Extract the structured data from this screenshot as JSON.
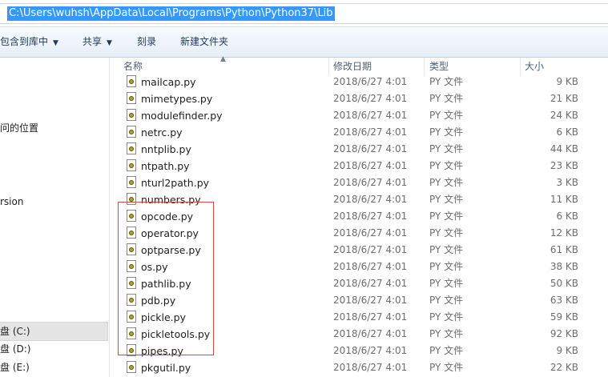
{
  "address_bar": {
    "path": "C:\\Users\\wuhsh\\AppData\\Local\\Programs\\Python\\Python37\\Lib"
  },
  "toolbar": {
    "include_in_library": "包含到库中",
    "share": "共享",
    "burn": "刻录",
    "new_folder": "新建文件夹"
  },
  "nav": {
    "recent_places": "问的位置",
    "version_item": "rsion",
    "drive_c": "盘 (C:)",
    "drive_d": "盘 (D:)",
    "drive_e": "盘 (E:)"
  },
  "columns": {
    "name": "名称",
    "date": "修改日期",
    "type": "类型",
    "size": "大小"
  },
  "files": [
    {
      "name": "mailcap.py",
      "date": "2018/6/27 4:01",
      "type": "PY 文件",
      "size": "9 KB"
    },
    {
      "name": "mimetypes.py",
      "date": "2018/6/27 4:01",
      "type": "PY 文件",
      "size": "21 KB"
    },
    {
      "name": "modulefinder.py",
      "date": "2018/6/27 4:01",
      "type": "PY 文件",
      "size": "24 KB"
    },
    {
      "name": "netrc.py",
      "date": "2018/6/27 4:01",
      "type": "PY 文件",
      "size": "6 KB"
    },
    {
      "name": "nntplib.py",
      "date": "2018/6/27 4:01",
      "type": "PY 文件",
      "size": "44 KB"
    },
    {
      "name": "ntpath.py",
      "date": "2018/6/27 4:01",
      "type": "PY 文件",
      "size": "23 KB"
    },
    {
      "name": "nturl2path.py",
      "date": "2018/6/27 4:01",
      "type": "PY 文件",
      "size": "3 KB"
    },
    {
      "name": "numbers.py",
      "date": "2018/6/27 4:01",
      "type": "PY 文件",
      "size": "11 KB"
    },
    {
      "name": "opcode.py",
      "date": "2018/6/27 4:01",
      "type": "PY 文件",
      "size": "6 KB"
    },
    {
      "name": "operator.py",
      "date": "2018/6/27 4:01",
      "type": "PY 文件",
      "size": "12 KB"
    },
    {
      "name": "optparse.py",
      "date": "2018/6/27 4:01",
      "type": "PY 文件",
      "size": "61 KB"
    },
    {
      "name": "os.py",
      "date": "2018/6/27 4:01",
      "type": "PY 文件",
      "size": "38 KB"
    },
    {
      "name": "pathlib.py",
      "date": "2018/6/27 4:01",
      "type": "PY 文件",
      "size": "50 KB"
    },
    {
      "name": "pdb.py",
      "date": "2018/6/27 4:01",
      "type": "PY 文件",
      "size": "63 KB"
    },
    {
      "name": "pickle.py",
      "date": "2018/6/27 4:01",
      "type": "PY 文件",
      "size": "59 KB"
    },
    {
      "name": "pickletools.py",
      "date": "2018/6/27 4:01",
      "type": "PY 文件",
      "size": "92 KB"
    },
    {
      "name": "pipes.py",
      "date": "2018/6/27 4:01",
      "type": "PY 文件",
      "size": "9 KB"
    },
    {
      "name": "pkgutil.py",
      "date": "2018/6/27 4:01",
      "type": "PY 文件",
      "size": "22 KB"
    }
  ],
  "colors": {
    "selection": "#3399ff",
    "annotation_box": "#d24b4b",
    "file_icon_accent": "#b8a31f"
  },
  "icons": [
    "python-file-icon",
    "chevron-down-icon",
    "sort-up-icon"
  ]
}
